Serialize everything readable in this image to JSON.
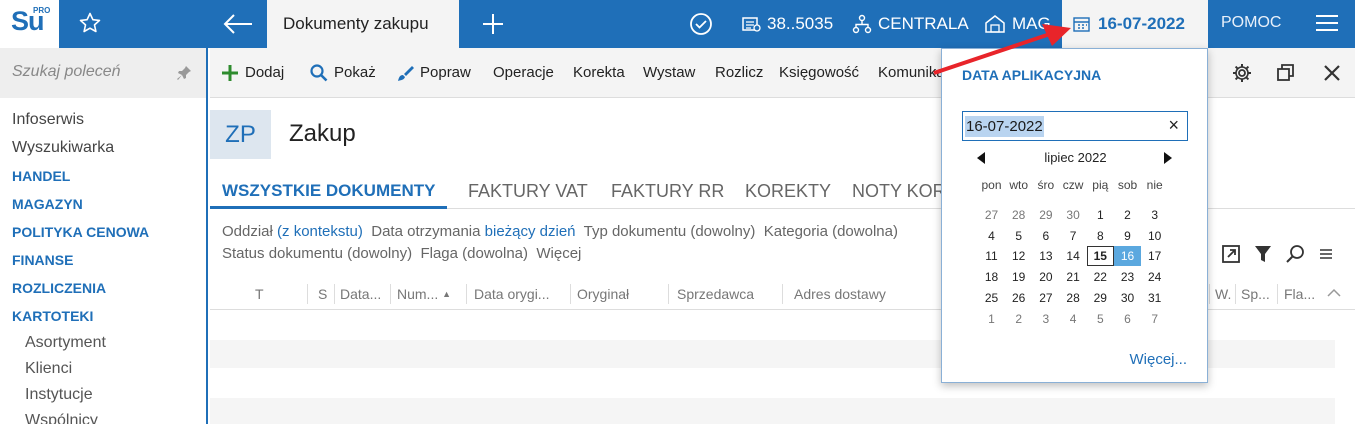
{
  "topbar": {
    "logo_text": "Su",
    "logo_pro": "PRO",
    "active_tab": "Dokumenty zakupu",
    "db_label": "38..5035",
    "centrala": "CENTRALA",
    "mag": "MAG",
    "date": "16-07-2022",
    "help": "POMOC"
  },
  "sidebar": {
    "search_placeholder": "Szukaj poleceń",
    "items": [
      {
        "label": "Infoserwis",
        "type": "plain"
      },
      {
        "label": "Wyszukiwarka",
        "type": "plain"
      },
      {
        "label": "HANDEL",
        "type": "bold"
      },
      {
        "label": "MAGAZYN",
        "type": "bold"
      },
      {
        "label": "POLITYKA CENOWA",
        "type": "bold"
      },
      {
        "label": "FINANSE",
        "type": "bold"
      },
      {
        "label": "ROZLICZENIA",
        "type": "bold"
      },
      {
        "label": "KARTOTEKI",
        "type": "bold"
      },
      {
        "label": "Asortyment",
        "type": "sub"
      },
      {
        "label": "Klienci",
        "type": "sub"
      },
      {
        "label": "Instytucje",
        "type": "sub"
      },
      {
        "label": "Wspólnicy",
        "type": "sub"
      }
    ]
  },
  "toolbar": {
    "add": "Dodaj",
    "show": "Pokaż",
    "edit": "Popraw",
    "operations": "Operacje",
    "correction": "Korekta",
    "issue": "Wystaw",
    "settle": "Rozlicz",
    "accounting": "Księgowość",
    "comm": "Komunika"
  },
  "main": {
    "badge": "ZP",
    "title": "Zakup",
    "tabs": [
      "WSZYSTKIE DOKUMENTY",
      "FAKTURY VAT",
      "FAKTURY RR",
      "KOREKTY",
      "NOTY KORY"
    ],
    "filters": {
      "branch_label": "Oddział",
      "branch_value": "(z kontekstu)",
      "received_label": "Data otrzymania",
      "received_value": "bieżący dzień",
      "doctype": "Typ dokumentu (dowolny)",
      "category": "Kategoria (dowolna)",
      "status": "Status dokumentu (dowolny)",
      "flag": "Flaga (dowolna)",
      "more": "Więcej"
    },
    "columns": [
      "T",
      "S",
      "Data...",
      "Num...",
      "Data orygi...",
      "Oryginał",
      "Sprzedawca",
      "Adres dostawy",
      "W.",
      "Sp...",
      "Fla..."
    ]
  },
  "popup": {
    "title": "DATA APLIKACYJNA",
    "input_value": "16-07-2022",
    "clear": "×",
    "month": "lipiec 2022",
    "weekdays": [
      "pon",
      "wto",
      "śro",
      "czw",
      "pią",
      "sob",
      "nie"
    ],
    "weeks": [
      [
        "27",
        "28",
        "29",
        "30",
        "1",
        "2",
        "3"
      ],
      [
        "4",
        "5",
        "6",
        "7",
        "8",
        "9",
        "10"
      ],
      [
        "11",
        "12",
        "13",
        "14",
        "15",
        "16",
        "17"
      ],
      [
        "18",
        "19",
        "20",
        "21",
        "22",
        "23",
        "24"
      ],
      [
        "25",
        "26",
        "27",
        "28",
        "29",
        "30",
        "31"
      ],
      [
        "1",
        "2",
        "3",
        "4",
        "5",
        "6",
        "7"
      ]
    ],
    "today": "15",
    "selected": "16",
    "more": "Więcej..."
  },
  "colors": {
    "primary": "#1f6fb8",
    "selected_day": "#5ba8df",
    "arrow": "#e8242a"
  }
}
